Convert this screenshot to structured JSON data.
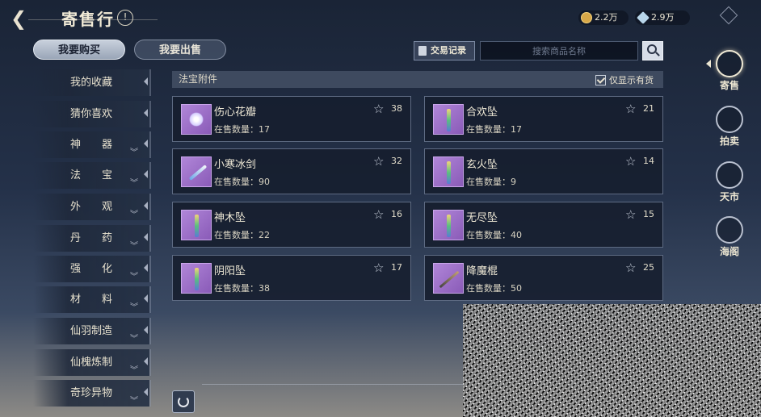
{
  "header": {
    "title": "寄售行",
    "back_icon": "back-arrow-icon",
    "info_icon": "info-icon",
    "info_symbol": "!"
  },
  "currencies": [
    {
      "name": "gold-coin",
      "icon": "gold-coin-icon",
      "value": "2.2万",
      "color": "#d8a848"
    },
    {
      "name": "gem",
      "icon": "gem-icon",
      "value": "2.9万",
      "color": "#b8d6ea"
    }
  ],
  "tabs": {
    "buy": "我要购买",
    "sell": "我要出售",
    "active": "buy"
  },
  "toolbar": {
    "trade_log": "交易记录",
    "search_placeholder": "搜索商品名称"
  },
  "sidebar": {
    "items": [
      {
        "label": "我的收藏",
        "expandable": false
      },
      {
        "label": "猜你喜欢",
        "expandable": false
      },
      {
        "label": "神　　器",
        "expandable": true
      },
      {
        "label": "法　　宝",
        "expandable": true
      },
      {
        "label": "外　　观",
        "expandable": true
      },
      {
        "label": "丹　　药",
        "expandable": true
      },
      {
        "label": "强　　化",
        "expandable": true
      },
      {
        "label": "材　　料",
        "expandable": true
      },
      {
        "label": "仙羽制造",
        "expandable": true
      },
      {
        "label": "仙槐炼制",
        "expandable": true
      },
      {
        "label": "奇珍异物",
        "expandable": true
      }
    ]
  },
  "section": {
    "title": "法宝附件",
    "stock_only_label": "仅显示有货",
    "stock_only_checked": true
  },
  "qty_prefix": "在售数量：",
  "items": [
    {
      "name": "伤心花瓣",
      "qty": "17",
      "fav": "38",
      "shape": "flower"
    },
    {
      "name": "合欢坠",
      "qty": "17",
      "fav": "21",
      "shape": "pendant"
    },
    {
      "name": "小寒冰剑",
      "qty": "90",
      "fav": "32",
      "shape": "sword"
    },
    {
      "name": "玄火坠",
      "qty": "9",
      "fav": "14",
      "shape": "pendant"
    },
    {
      "name": "神木坠",
      "qty": "22",
      "fav": "16",
      "shape": "pendant"
    },
    {
      "name": "无尽坠",
      "qty": "40",
      "fav": "15",
      "shape": "pendant"
    },
    {
      "name": "阴阳坠",
      "qty": "38",
      "fav": "17",
      "shape": "pendant"
    },
    {
      "name": "降魔棍",
      "qty": "50",
      "fav": "25",
      "shape": "staff"
    }
  ],
  "right_nav": [
    {
      "label": "寄售",
      "active": true
    },
    {
      "label": "拍卖",
      "active": false
    },
    {
      "label": "天市",
      "active": false
    },
    {
      "label": "海阁",
      "active": false
    }
  ],
  "accent_color": "#d7dde8"
}
